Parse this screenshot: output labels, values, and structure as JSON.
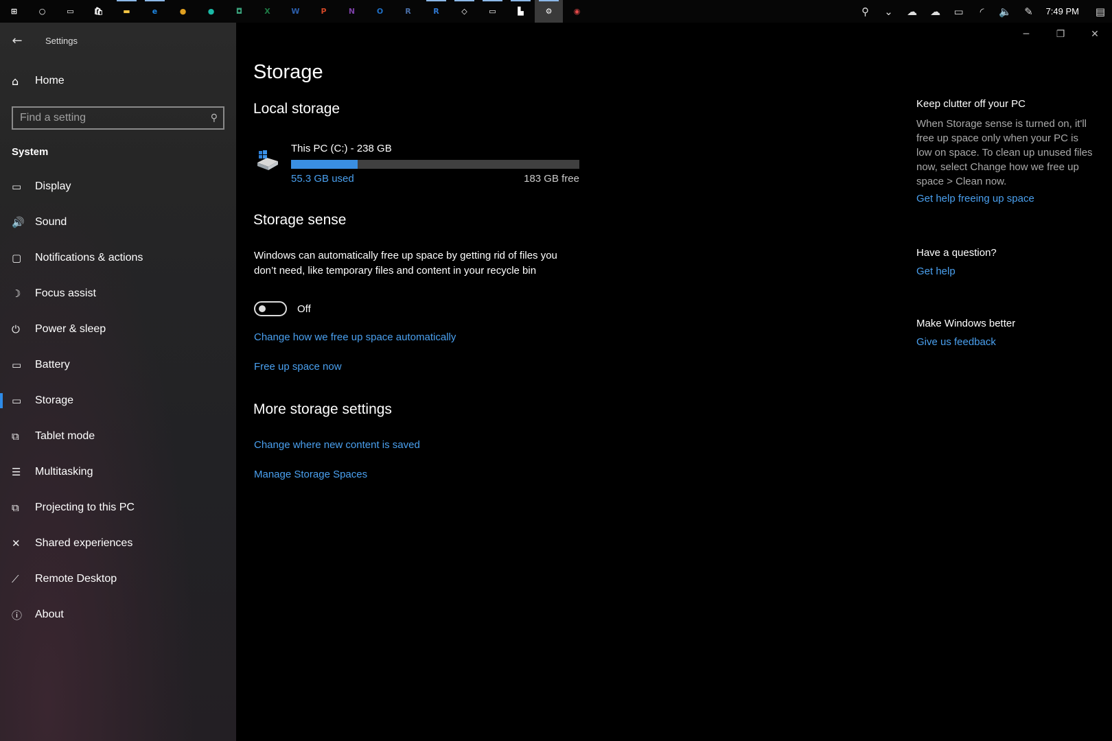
{
  "taskbar": {
    "icons": [
      {
        "name": "start-icon",
        "glyph": "⊞",
        "color": "#ffffff"
      },
      {
        "name": "cortana-icon",
        "glyph": "○",
        "color": "#ffffff"
      },
      {
        "name": "task-view-icon",
        "glyph": "▭",
        "color": "#ffffff"
      },
      {
        "name": "store-icon",
        "glyph": "🛍",
        "color": "#ffffff"
      },
      {
        "name": "file-explorer-icon",
        "glyph": "▬",
        "color": "#f3c544"
      },
      {
        "name": "edge-icon",
        "glyph": "e",
        "color": "#1e88e5"
      },
      {
        "name": "chrome-icon",
        "glyph": "●",
        "color": "#e0a020"
      },
      {
        "name": "app-teal-icon",
        "glyph": "●",
        "color": "#1ab9a6"
      },
      {
        "name": "app-green-icon",
        "glyph": "◘",
        "color": "#3aa17b"
      },
      {
        "name": "excel-icon",
        "glyph": "X",
        "color": "#1e7b45"
      },
      {
        "name": "word-icon",
        "glyph": "W",
        "color": "#2b5eab"
      },
      {
        "name": "powerpoint-icon",
        "glyph": "P",
        "color": "#d24726"
      },
      {
        "name": "onenote-icon",
        "glyph": "N",
        "color": "#7b3fa6"
      },
      {
        "name": "outlook-icon",
        "glyph": "O",
        "color": "#1f6fc5"
      },
      {
        "name": "r-icon",
        "glyph": "R",
        "color": "#4a6fa8"
      },
      {
        "name": "rstudio-icon",
        "glyph": "R",
        "color": "#2f78d2"
      },
      {
        "name": "snip-icon",
        "glyph": "◇",
        "color": "#ffffff"
      },
      {
        "name": "terminal-icon",
        "glyph": "▭",
        "color": "#ffffff"
      },
      {
        "name": "device-icon",
        "glyph": "▙",
        "color": "#ffffff"
      },
      {
        "name": "settings-gear-icon",
        "glyph": "⚙",
        "color": "#ffffff"
      },
      {
        "name": "paint-icon",
        "glyph": "◉",
        "color": "#e04848"
      }
    ],
    "tray": [
      {
        "name": "people-icon",
        "glyph": "⚲"
      },
      {
        "name": "chevron-up-icon",
        "glyph": "⌄"
      },
      {
        "name": "onedrive-icon",
        "glyph": "☁"
      },
      {
        "name": "onedrive-business-icon",
        "glyph": "☁"
      },
      {
        "name": "battery-tray-icon",
        "glyph": "▭"
      },
      {
        "name": "wifi-icon",
        "glyph": "◜"
      },
      {
        "name": "volume-icon",
        "glyph": "🔈"
      },
      {
        "name": "pen-icon",
        "glyph": "✎"
      }
    ],
    "clock": "7:49 PM",
    "notification_glyph": "▤"
  },
  "sidebar": {
    "back_glyph": "←",
    "app_title": "Settings",
    "home": {
      "label": "Home",
      "glyph": "⌂"
    },
    "search": {
      "placeholder": "Find a setting",
      "icon": "⚲"
    },
    "section_label": "System",
    "items": [
      {
        "label": "Display",
        "glyph": "▭"
      },
      {
        "label": "Sound",
        "glyph": "🔊"
      },
      {
        "label": "Notifications & actions",
        "glyph": "▢"
      },
      {
        "label": "Focus assist",
        "glyph": "☽"
      },
      {
        "label": "Power & sleep",
        "glyph": "⏻"
      },
      {
        "label": "Battery",
        "glyph": "▭"
      },
      {
        "label": "Storage",
        "glyph": "▭"
      },
      {
        "label": "Tablet mode",
        "glyph": "⧉"
      },
      {
        "label": "Multitasking",
        "glyph": "☰"
      },
      {
        "label": "Projecting to this PC",
        "glyph": "⧉"
      },
      {
        "label": "Shared experiences",
        "glyph": "✕"
      },
      {
        "label": "Remote Desktop",
        "glyph": "⟋"
      },
      {
        "label": "About",
        "glyph": "ⓘ"
      }
    ],
    "selected_index": 6
  },
  "window": {
    "minimize": "─",
    "restore": "❐",
    "close": "✕"
  },
  "main": {
    "title": "Storage",
    "local_storage": {
      "heading": "Local storage",
      "drive_name": "This PC (C:) - 238 GB",
      "used": "55.3 GB used",
      "free": "183 GB free",
      "used_fraction": 0.232
    },
    "storage_sense": {
      "heading": "Storage sense",
      "description": "Windows can automatically free up space by getting rid of files you don’t need, like temporary files and content in your recycle bin",
      "toggle_state": "Off",
      "link_change": "Change how we free up space automatically",
      "link_free": "Free up space now"
    },
    "more": {
      "heading": "More storage settings",
      "link_content": "Change where new content is saved",
      "link_spaces": "Manage Storage Spaces"
    }
  },
  "right": {
    "clutter": {
      "heading": "Keep clutter off your PC",
      "text": "When Storage sense is turned on, it'll free up space only when your PC is low on space. To clean up unused files now, select Change how we free up space > Clean now.",
      "link": "Get help freeing up space"
    },
    "question": {
      "heading": "Have a question?",
      "link": "Get help"
    },
    "better": {
      "heading": "Make Windows better",
      "link": "Give us feedback"
    }
  },
  "colors": {
    "accent": "#2e8be8",
    "link": "#4aa0ef",
    "bar_fill": "#3a8fe2",
    "bar_track": "#404040"
  }
}
